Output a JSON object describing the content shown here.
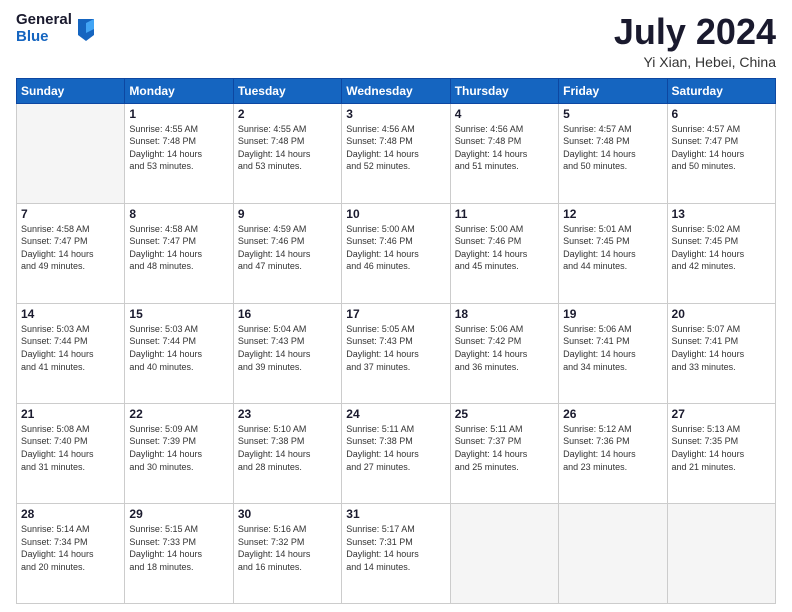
{
  "header": {
    "logo_general": "General",
    "logo_blue": "Blue",
    "month_title": "July 2024",
    "location": "Yi Xian, Hebei, China"
  },
  "weekdays": [
    "Sunday",
    "Monday",
    "Tuesday",
    "Wednesday",
    "Thursday",
    "Friday",
    "Saturday"
  ],
  "weeks": [
    [
      {
        "day": "",
        "sunrise": "",
        "sunset": "",
        "daylight": ""
      },
      {
        "day": "1",
        "sunrise": "Sunrise: 4:55 AM",
        "sunset": "Sunset: 7:48 PM",
        "daylight": "Daylight: 14 hours and 53 minutes."
      },
      {
        "day": "2",
        "sunrise": "Sunrise: 4:55 AM",
        "sunset": "Sunset: 7:48 PM",
        "daylight": "Daylight: 14 hours and 53 minutes."
      },
      {
        "day": "3",
        "sunrise": "Sunrise: 4:56 AM",
        "sunset": "Sunset: 7:48 PM",
        "daylight": "Daylight: 14 hours and 52 minutes."
      },
      {
        "day": "4",
        "sunrise": "Sunrise: 4:56 AM",
        "sunset": "Sunset: 7:48 PM",
        "daylight": "Daylight: 14 hours and 51 minutes."
      },
      {
        "day": "5",
        "sunrise": "Sunrise: 4:57 AM",
        "sunset": "Sunset: 7:48 PM",
        "daylight": "Daylight: 14 hours and 50 minutes."
      },
      {
        "day": "6",
        "sunrise": "Sunrise: 4:57 AM",
        "sunset": "Sunset: 7:47 PM",
        "daylight": "Daylight: 14 hours and 50 minutes."
      }
    ],
    [
      {
        "day": "7",
        "sunrise": "Sunrise: 4:58 AM",
        "sunset": "Sunset: 7:47 PM",
        "daylight": "Daylight: 14 hours and 49 minutes."
      },
      {
        "day": "8",
        "sunrise": "Sunrise: 4:58 AM",
        "sunset": "Sunset: 7:47 PM",
        "daylight": "Daylight: 14 hours and 48 minutes."
      },
      {
        "day": "9",
        "sunrise": "Sunrise: 4:59 AM",
        "sunset": "Sunset: 7:46 PM",
        "daylight": "Daylight: 14 hours and 47 minutes."
      },
      {
        "day": "10",
        "sunrise": "Sunrise: 5:00 AM",
        "sunset": "Sunset: 7:46 PM",
        "daylight": "Daylight: 14 hours and 46 minutes."
      },
      {
        "day": "11",
        "sunrise": "Sunrise: 5:00 AM",
        "sunset": "Sunset: 7:46 PM",
        "daylight": "Daylight: 14 hours and 45 minutes."
      },
      {
        "day": "12",
        "sunrise": "Sunrise: 5:01 AM",
        "sunset": "Sunset: 7:45 PM",
        "daylight": "Daylight: 14 hours and 44 minutes."
      },
      {
        "day": "13",
        "sunrise": "Sunrise: 5:02 AM",
        "sunset": "Sunset: 7:45 PM",
        "daylight": "Daylight: 14 hours and 42 minutes."
      }
    ],
    [
      {
        "day": "14",
        "sunrise": "Sunrise: 5:03 AM",
        "sunset": "Sunset: 7:44 PM",
        "daylight": "Daylight: 14 hours and 41 minutes."
      },
      {
        "day": "15",
        "sunrise": "Sunrise: 5:03 AM",
        "sunset": "Sunset: 7:44 PM",
        "daylight": "Daylight: 14 hours and 40 minutes."
      },
      {
        "day": "16",
        "sunrise": "Sunrise: 5:04 AM",
        "sunset": "Sunset: 7:43 PM",
        "daylight": "Daylight: 14 hours and 39 minutes."
      },
      {
        "day": "17",
        "sunrise": "Sunrise: 5:05 AM",
        "sunset": "Sunset: 7:43 PM",
        "daylight": "Daylight: 14 hours and 37 minutes."
      },
      {
        "day": "18",
        "sunrise": "Sunrise: 5:06 AM",
        "sunset": "Sunset: 7:42 PM",
        "daylight": "Daylight: 14 hours and 36 minutes."
      },
      {
        "day": "19",
        "sunrise": "Sunrise: 5:06 AM",
        "sunset": "Sunset: 7:41 PM",
        "daylight": "Daylight: 14 hours and 34 minutes."
      },
      {
        "day": "20",
        "sunrise": "Sunrise: 5:07 AM",
        "sunset": "Sunset: 7:41 PM",
        "daylight": "Daylight: 14 hours and 33 minutes."
      }
    ],
    [
      {
        "day": "21",
        "sunrise": "Sunrise: 5:08 AM",
        "sunset": "Sunset: 7:40 PM",
        "daylight": "Daylight: 14 hours and 31 minutes."
      },
      {
        "day": "22",
        "sunrise": "Sunrise: 5:09 AM",
        "sunset": "Sunset: 7:39 PM",
        "daylight": "Daylight: 14 hours and 30 minutes."
      },
      {
        "day": "23",
        "sunrise": "Sunrise: 5:10 AM",
        "sunset": "Sunset: 7:38 PM",
        "daylight": "Daylight: 14 hours and 28 minutes."
      },
      {
        "day": "24",
        "sunrise": "Sunrise: 5:11 AM",
        "sunset": "Sunset: 7:38 PM",
        "daylight": "Daylight: 14 hours and 27 minutes."
      },
      {
        "day": "25",
        "sunrise": "Sunrise: 5:11 AM",
        "sunset": "Sunset: 7:37 PM",
        "daylight": "Daylight: 14 hours and 25 minutes."
      },
      {
        "day": "26",
        "sunrise": "Sunrise: 5:12 AM",
        "sunset": "Sunset: 7:36 PM",
        "daylight": "Daylight: 14 hours and 23 minutes."
      },
      {
        "day": "27",
        "sunrise": "Sunrise: 5:13 AM",
        "sunset": "Sunset: 7:35 PM",
        "daylight": "Daylight: 14 hours and 21 minutes."
      }
    ],
    [
      {
        "day": "28",
        "sunrise": "Sunrise: 5:14 AM",
        "sunset": "Sunset: 7:34 PM",
        "daylight": "Daylight: 14 hours and 20 minutes."
      },
      {
        "day": "29",
        "sunrise": "Sunrise: 5:15 AM",
        "sunset": "Sunset: 7:33 PM",
        "daylight": "Daylight: 14 hours and 18 minutes."
      },
      {
        "day": "30",
        "sunrise": "Sunrise: 5:16 AM",
        "sunset": "Sunset: 7:32 PM",
        "daylight": "Daylight: 14 hours and 16 minutes."
      },
      {
        "day": "31",
        "sunrise": "Sunrise: 5:17 AM",
        "sunset": "Sunset: 7:31 PM",
        "daylight": "Daylight: 14 hours and 14 minutes."
      },
      {
        "day": "",
        "sunrise": "",
        "sunset": "",
        "daylight": ""
      },
      {
        "day": "",
        "sunrise": "",
        "sunset": "",
        "daylight": ""
      },
      {
        "day": "",
        "sunrise": "",
        "sunset": "",
        "daylight": ""
      }
    ]
  ]
}
